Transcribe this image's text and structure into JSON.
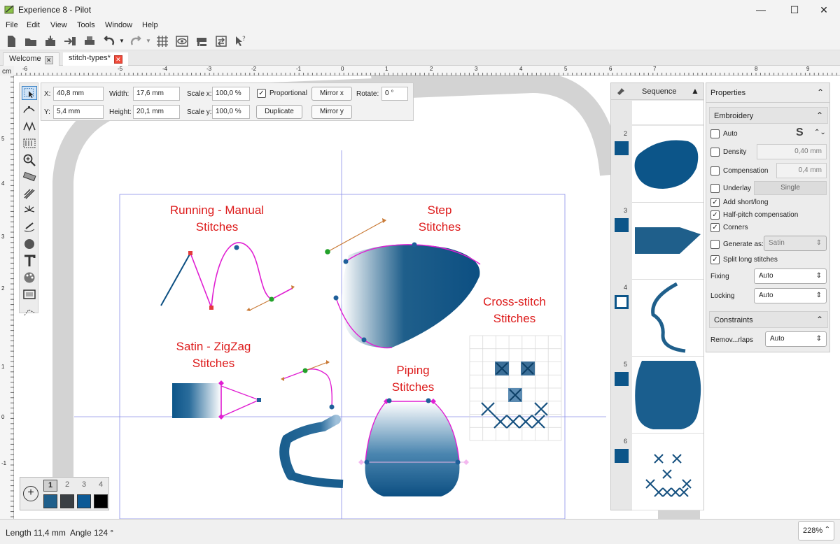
{
  "window": {
    "title": "Experience 8 - Pilot",
    "minimize": "—",
    "maximize": "☐",
    "close": "✕"
  },
  "menu": [
    "File",
    "Edit",
    "View",
    "Tools",
    "Window",
    "Help"
  ],
  "tabs": [
    {
      "label": "Welcome",
      "close": "✕"
    },
    {
      "label": "stitch-types*",
      "close": "✕"
    }
  ],
  "ruler": {
    "unit": "cm",
    "top_labels": [
      "-6",
      "-5",
      "-4",
      "-3",
      "-2",
      "-1",
      "0",
      "1",
      "2",
      "3",
      "4",
      "5",
      "6",
      "7",
      "8",
      "9"
    ],
    "left_labels": [
      "5",
      "4",
      "3",
      "2",
      "1",
      "0",
      "-1"
    ]
  },
  "transform": {
    "x_label": "X:",
    "x_value": "40,8 mm",
    "y_label": "Y:",
    "y_value": "5,4 mm",
    "width_label": "Width:",
    "width_value": "17,6 mm",
    "height_label": "Height:",
    "height_value": "20,1 mm",
    "scalex_label": "Scale x:",
    "scalex_value": "100,0 %",
    "scaley_label": "Scale y:",
    "scaley_value": "100,0 %",
    "proportional_label": "Proportional",
    "duplicate_label": "Duplicate",
    "mirrorx_label": "Mirror x",
    "mirrory_label": "Mirror y",
    "rotate_label": "Rotate:",
    "rotate_value": "0 °"
  },
  "canvas_labels": {
    "running": [
      "Running - Manual",
      "Stitches"
    ],
    "step": [
      "Step",
      "Stitches"
    ],
    "cross": [
      "Cross-stitch",
      "Stitches"
    ],
    "satin": [
      "Satin - ZigZag",
      "Stitches"
    ],
    "piping": [
      "Piping",
      "Stitches"
    ]
  },
  "sequence": {
    "title": "Sequence",
    "items": [
      {
        "num": "2",
        "swatch": "filled"
      },
      {
        "num": "3",
        "swatch": "filled"
      },
      {
        "num": "4",
        "swatch": "outline"
      },
      {
        "num": "5",
        "swatch": "filled"
      },
      {
        "num": "6",
        "swatch": "filled"
      }
    ]
  },
  "properties": {
    "title": "Properties",
    "embroidery_title": "Embroidery",
    "auto_label": "Auto",
    "density_label": "Density",
    "density_value": "0,40 mm",
    "compensation_label": "Compensation",
    "compensation_value": "0,4 mm",
    "underlay_label": "Underlay",
    "underlay_value": "Single",
    "add_short_long_label": "Add short/long",
    "half_pitch_label": "Half-pitch compensation",
    "corners_label": "Corners",
    "generate_as_label": "Generate as:",
    "generate_as_value": "Satin",
    "split_long_label": "Split long stitches",
    "fixing_label": "Fixing",
    "fixing_value": "Auto",
    "locking_label": "Locking",
    "locking_value": "Auto",
    "constraints_title": "Constraints",
    "remove_overlaps_label": "Remov...rlaps",
    "remove_overlaps_value": "Auto"
  },
  "palette": {
    "add": "+",
    "tabs": [
      "1",
      "2",
      "3",
      "4"
    ],
    "colors": [
      "#1f5f8b",
      "#3a3f44",
      "#0d5a96",
      "#000000"
    ]
  },
  "status": {
    "length": "Length 11,4 mm",
    "angle": "Angle 124 °",
    "zoom": "228%"
  },
  "colors": {
    "accent": "#0c5589",
    "label_red": "#dd1a1a",
    "magenta": "#e01fd2"
  }
}
